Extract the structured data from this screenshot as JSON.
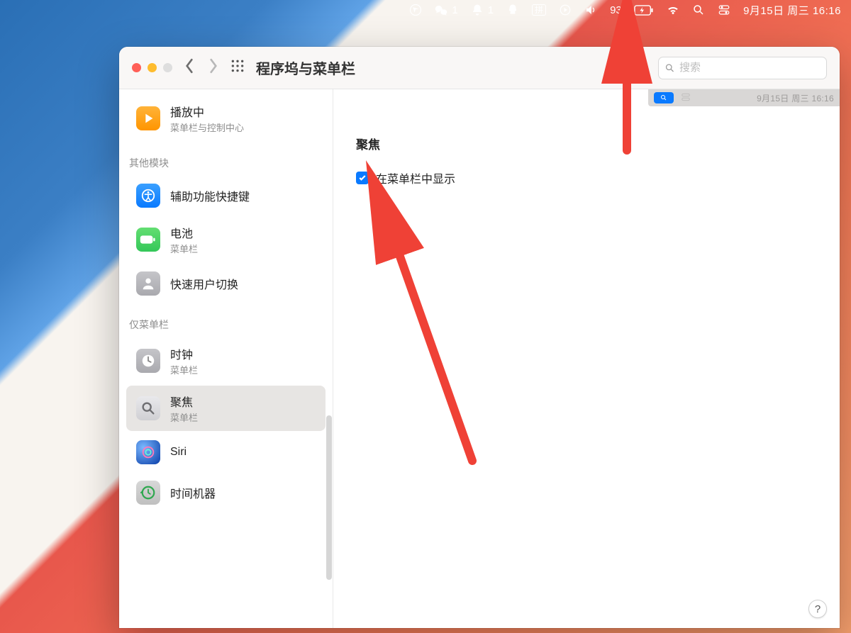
{
  "menubar": {
    "wechat_badge": "1",
    "qq_badge": "1",
    "ime_label": "拼",
    "battery_pct": "93%",
    "datetime": "9月15日 周三  16:16"
  },
  "toolbar": {
    "title": "程序坞与菜单栏",
    "search_placeholder": "搜索"
  },
  "sidebar": {
    "nowplaying": {
      "title": "播放中",
      "sub": "菜单栏与控制中心"
    },
    "sect_other": "其他模块",
    "accessibility": {
      "title": "辅助功能快捷键"
    },
    "battery": {
      "title": "电池",
      "sub": "菜单栏"
    },
    "fastswitch": {
      "title": "快速用户切换"
    },
    "sect_menubar": "仅菜单栏",
    "clock": {
      "title": "时钟",
      "sub": "菜单栏"
    },
    "spotlight": {
      "title": "聚焦",
      "sub": "菜单栏"
    },
    "siri": {
      "title": "Siri"
    },
    "timemachine": {
      "title": "时间机器"
    }
  },
  "pane": {
    "heading": "聚焦",
    "checkbox_label": "在菜单栏中显示",
    "mini_datetime": "9月15日 周三  16:16"
  },
  "help": "?"
}
